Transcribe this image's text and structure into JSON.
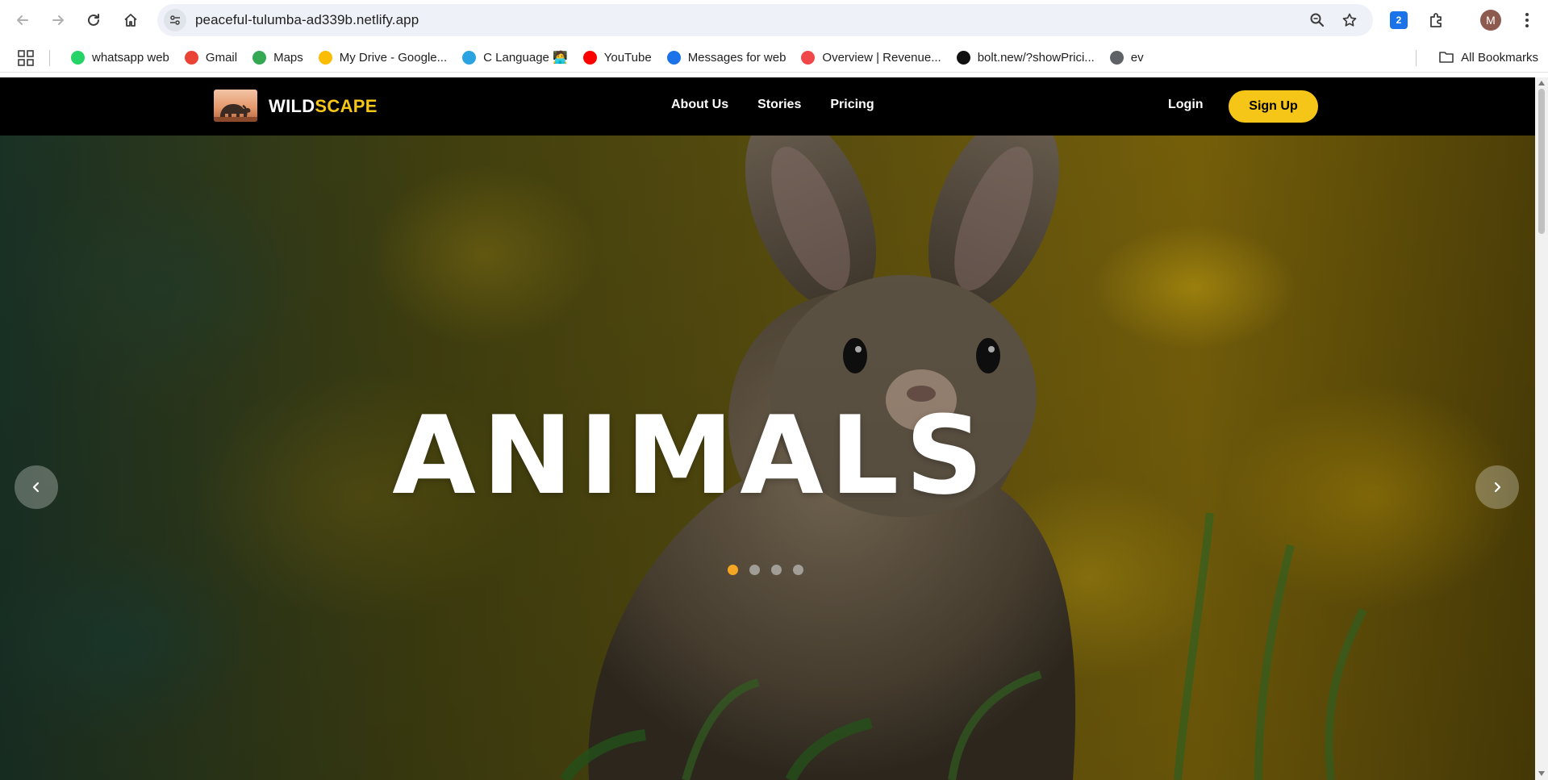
{
  "browser": {
    "url": "peaceful-tulumba-ad339b.netlify.app",
    "profile_initial": "M",
    "extension_badge": "2",
    "icons": [
      "back-icon",
      "forward-icon",
      "reload-icon",
      "home-icon",
      "site-info-icon",
      "zoom-icon",
      "star-icon",
      "extension-icon",
      "puzzle-icon",
      "more-icon"
    ]
  },
  "bookmarks": {
    "items": [
      {
        "label": "whatsapp web",
        "color": "#25d366"
      },
      {
        "label": "Gmail",
        "color": "#ea4335"
      },
      {
        "label": "Maps",
        "color": "#34a853"
      },
      {
        "label": "My Drive - Google...",
        "color": "#fbbc04"
      },
      {
        "label": "C Language 🧑‍💻",
        "color": "#2aa3e0"
      },
      {
        "label": "YouTube",
        "color": "#ff0000"
      },
      {
        "label": "Messages for web",
        "color": "#1a73e8"
      },
      {
        "label": "Overview | Revenue...",
        "color": "#f04848"
      },
      {
        "label": "bolt.new/?showPrici...",
        "color": "#111111"
      },
      {
        "label": "ev",
        "color": "#5f6368"
      }
    ],
    "all_bookmarks": "All Bookmarks"
  },
  "site": {
    "logo": {
      "wild": "WILD",
      "scape": "SCAPE"
    },
    "nav": [
      "About Us",
      "Stories",
      "Pricing"
    ],
    "login": "Login",
    "signup": "Sign Up",
    "accent": "#f5c518"
  },
  "hero": {
    "title": "ANIMALS",
    "slide_count": 4,
    "active_slide": 1,
    "dot_active_color": "#f5a623"
  }
}
